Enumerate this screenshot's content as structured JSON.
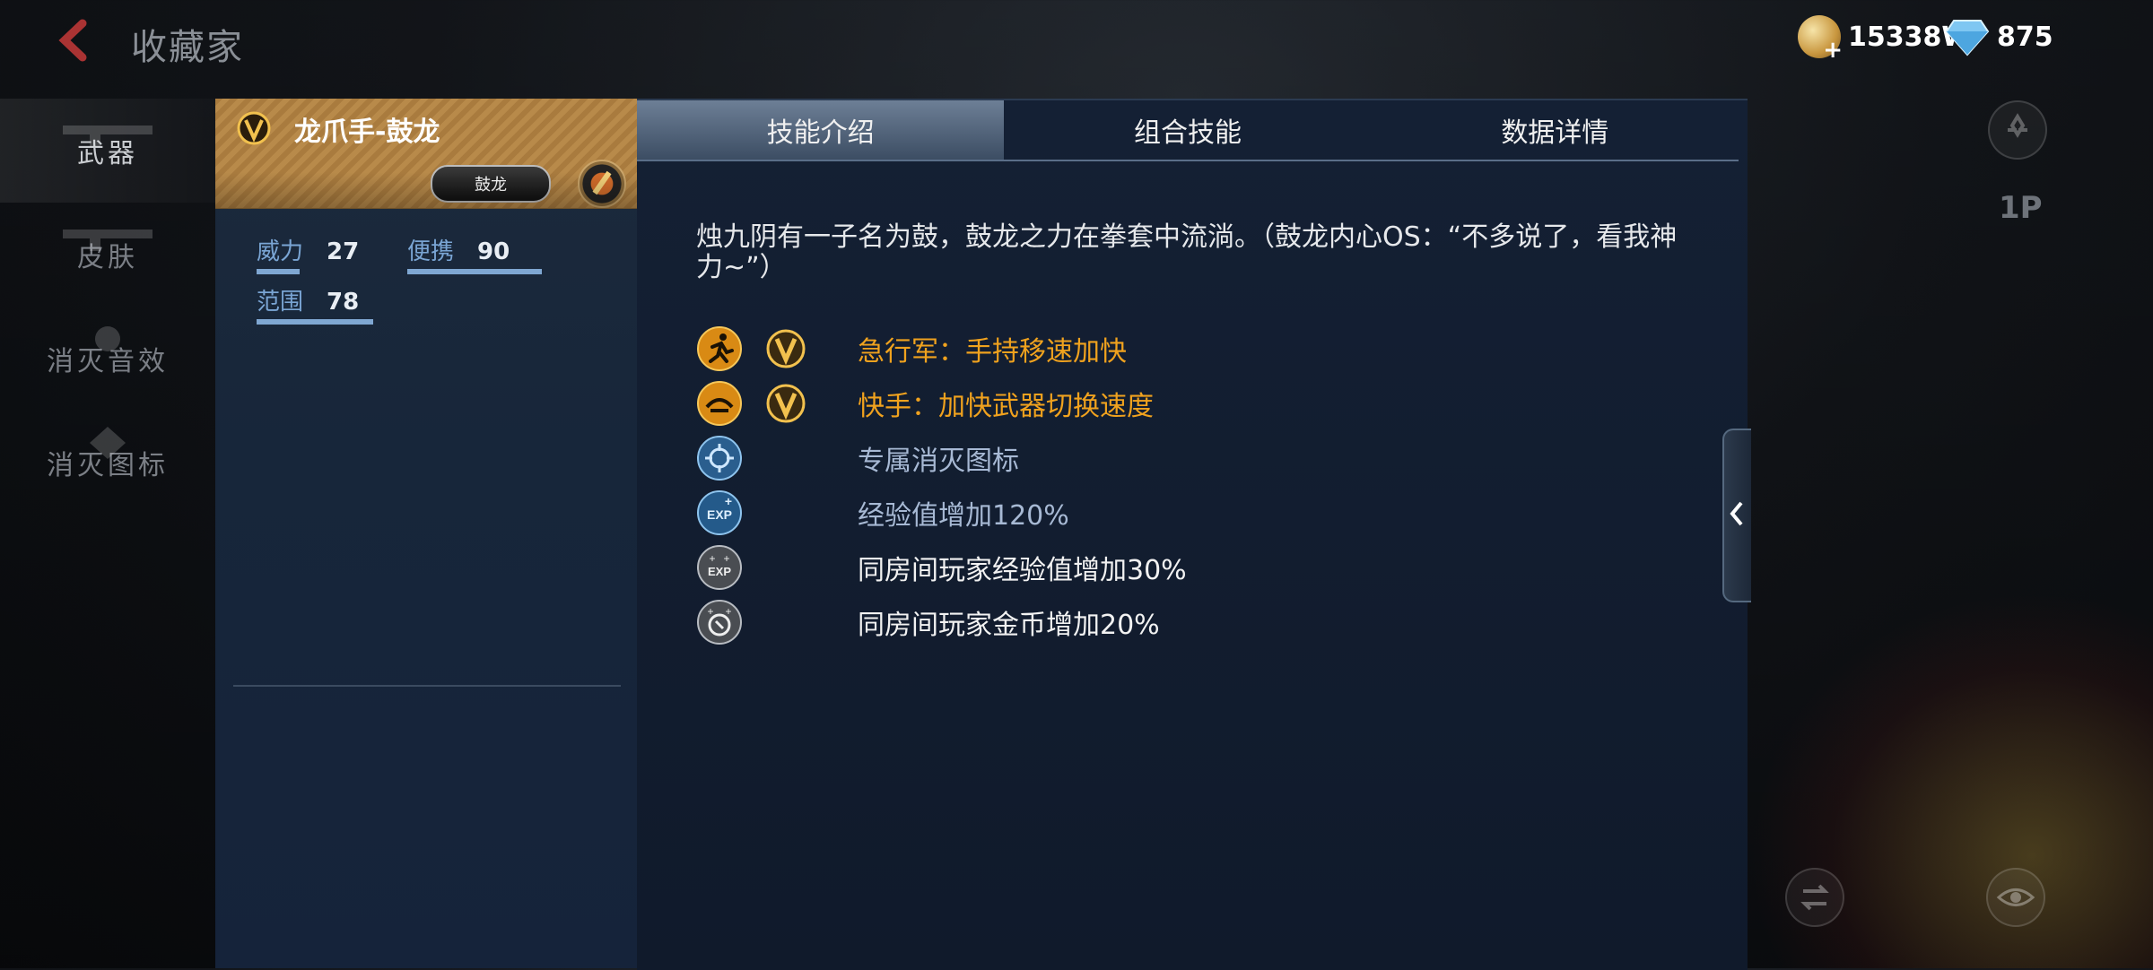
{
  "header": {
    "title": "收藏家",
    "gold_amount": "15338W",
    "diamond_amount": "875"
  },
  "nav": {
    "items": [
      {
        "label": "武器"
      },
      {
        "label": "皮肤"
      },
      {
        "label": "消灭音效"
      },
      {
        "label": "消灭图标"
      }
    ]
  },
  "weapon": {
    "name": "龙爪手-鼓龙",
    "badge": "鼓龙",
    "stats": [
      {
        "label": "威力",
        "value": "27"
      },
      {
        "label": "便携",
        "value": "90"
      },
      {
        "label": "范围",
        "value": "78"
      }
    ]
  },
  "tabs": [
    {
      "label": "技能介绍"
    },
    {
      "label": "组合技能"
    },
    {
      "label": "数据详情"
    }
  ],
  "description": "烛九阴有一子名为鼓，鼓龙之力在拳套中流淌。（鼓龙内心OS：“不多说了，看我神力~”）",
  "skills": [
    {
      "text": "急行军：手持移速加快",
      "icon": "running-icon",
      "color": "#f0a21e"
    },
    {
      "text": "快手：加快武器切换速度",
      "icon": "quick-hand-icon",
      "color": "#f0a21e"
    },
    {
      "text": "专属消灭图标",
      "icon": "kill-icon",
      "color": "#a7b9d4"
    },
    {
      "text": "经验值增加120%",
      "icon": "exp-icon",
      "color": "#a7b9d4"
    },
    {
      "text": "同房间玩家经验值增加30%",
      "icon": "room-exp-icon",
      "color": "#f2f2f2"
    },
    {
      "text": "同房间玩家金币增加20%",
      "icon": "room-coin-icon",
      "color": "#f2f2f2"
    }
  ],
  "right": {
    "player_label": "1P"
  },
  "colors": {
    "accent_orange": "#f0a21e",
    "panel_blue": "#142034",
    "tab_active": "#6d7f96"
  }
}
